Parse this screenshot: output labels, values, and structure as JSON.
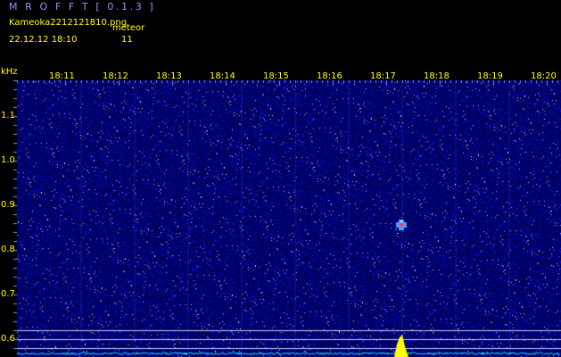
{
  "header": {
    "app_title": "M R O F F T  [ 0.1.3 ]",
    "filename": "Kameoka2212121810.png",
    "event_type": "meteor",
    "datetime": "22.12.12  18:10",
    "count": "11"
  },
  "colors": {
    "background": "#000000",
    "header_title": "#8c96ff",
    "labels": "#ffff00",
    "noise_field": "#00007a",
    "detection": "#ffff00",
    "baseline": "#00ffff"
  },
  "chart_data": {
    "type": "heatmap",
    "xlabel": "",
    "ylabel": "kHz",
    "time_ticks": [
      "18:11",
      "18:12",
      "18:13",
      "18:14",
      "18:15",
      "18:16",
      "18:17",
      "18:18",
      "18:19",
      "18:20"
    ],
    "freq_ticks": [
      "1.1",
      "1.0",
      "0.9",
      "0.8",
      "0.7",
      "0.6"
    ],
    "detections": [
      {
        "label": "meteor echo",
        "time": "18:17:33",
        "freq_khz": 0.85
      }
    ]
  }
}
